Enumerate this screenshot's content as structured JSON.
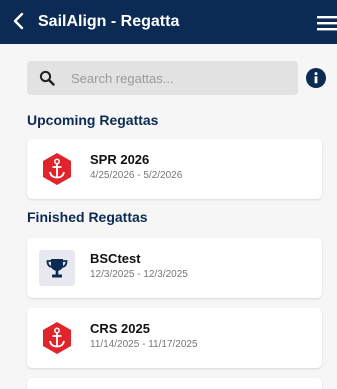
{
  "header": {
    "title": "SailAlign - Regatta"
  },
  "search": {
    "placeholder": "Search regattas..."
  },
  "sections": {
    "upcoming_title": "Upcoming Regattas",
    "finished_title": "Finished Regattas"
  },
  "upcoming": [
    {
      "name": "SPR 2026",
      "dates": "4/25/2026 - 5/2/2026",
      "icon": "anchor-icon"
    }
  ],
  "finished": [
    {
      "name": "BSCtest",
      "dates": "12/3/2025 - 12/3/2025",
      "icon": "trophy-icon"
    },
    {
      "name": "CRS 2025",
      "dates": "11/14/2025 - 11/17/2025",
      "icon": "anchor-icon"
    }
  ],
  "colors": {
    "navy": "#0b2b54",
    "anchor_red": "#e0242b",
    "background": "#f6f6f6"
  }
}
